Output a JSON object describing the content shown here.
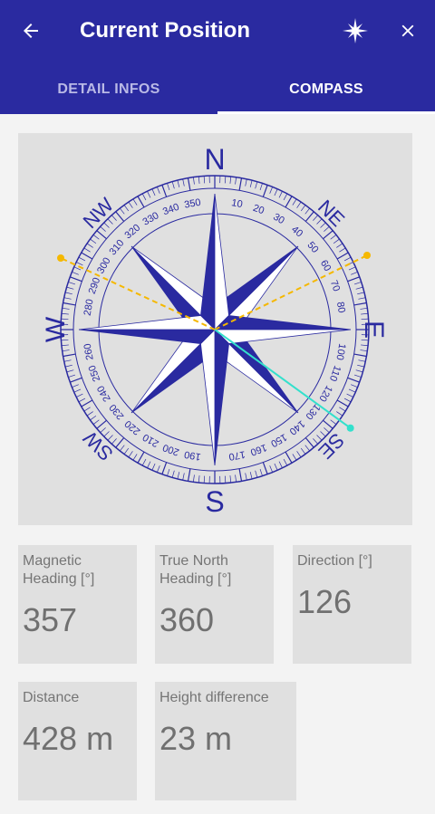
{
  "appbar": {
    "title": "Current Position",
    "back_icon": "arrow-left-icon",
    "compass_icon": "compass-rose-icon",
    "close_icon": "close-icon",
    "color": "#2a2aa0"
  },
  "tabs": [
    {
      "label": "DETAIL INFOS",
      "selected": false
    },
    {
      "label": "COMPASS",
      "selected": true
    }
  ],
  "compass": {
    "cardinals": {
      "n": "N",
      "e": "E",
      "s": "S",
      "w": "W"
    },
    "intercardinals": {
      "ne": "NE",
      "se": "SE",
      "sw": "SW",
      "nw": "NW"
    },
    "degree_labels": [
      "10",
      "20",
      "30",
      "40",
      "50",
      "60",
      "70",
      "80",
      "100",
      "110",
      "120",
      "130",
      "140",
      "150",
      "160",
      "170",
      "190",
      "200",
      "210",
      "220",
      "230",
      "240",
      "250",
      "260",
      "280",
      "290",
      "300",
      "310",
      "320",
      "330",
      "340",
      "350"
    ],
    "direction_deg": 126,
    "line_color_direction": "#33e0cc",
    "line_color_reference": "#f5b800",
    "rose_color": "#2a2aa0"
  },
  "cards": {
    "magnetic": {
      "label": "Magnetic Heading [°]",
      "value": "357"
    },
    "true_north": {
      "label": "True North Heading [°]",
      "value": "360"
    },
    "direction": {
      "label": "Direction [°]",
      "value": "126"
    },
    "distance": {
      "label": "Distance",
      "value": "428 m"
    },
    "height": {
      "label": "Height difference",
      "value": "23 m"
    }
  }
}
